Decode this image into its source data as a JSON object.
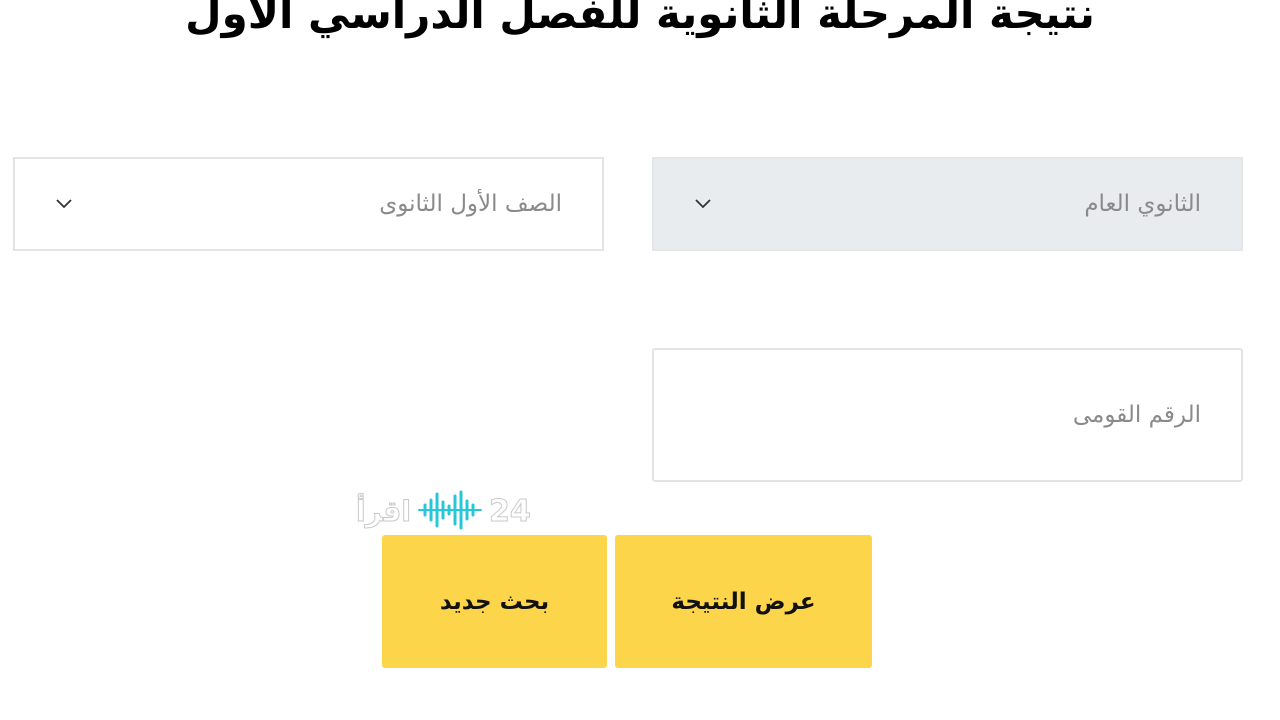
{
  "page": {
    "title": "نتيجة المرحلة الثانوية للفصل الدراسي الأول"
  },
  "form": {
    "track_select": {
      "value": "الثانوي العام",
      "icon": "chevron-down-icon"
    },
    "grade_select": {
      "value": "الصف الأول الثانوى",
      "icon": "chevron-down-icon"
    },
    "national_id": {
      "placeholder": "الرقم القومى",
      "value": ""
    }
  },
  "buttons": {
    "show_result": "عرض النتيجة",
    "new_search": "بحث جديد"
  },
  "watermark": {
    "brand_text": "اقرأ",
    "brand_number": "24",
    "icon": "sound-wave-icon",
    "accent_color": "#25c7d9"
  },
  "colors": {
    "button": "#fdd54b",
    "disabled_select": "#e9ecef",
    "border": "#e3e3e3",
    "placeholder": "#8a8a8a"
  }
}
